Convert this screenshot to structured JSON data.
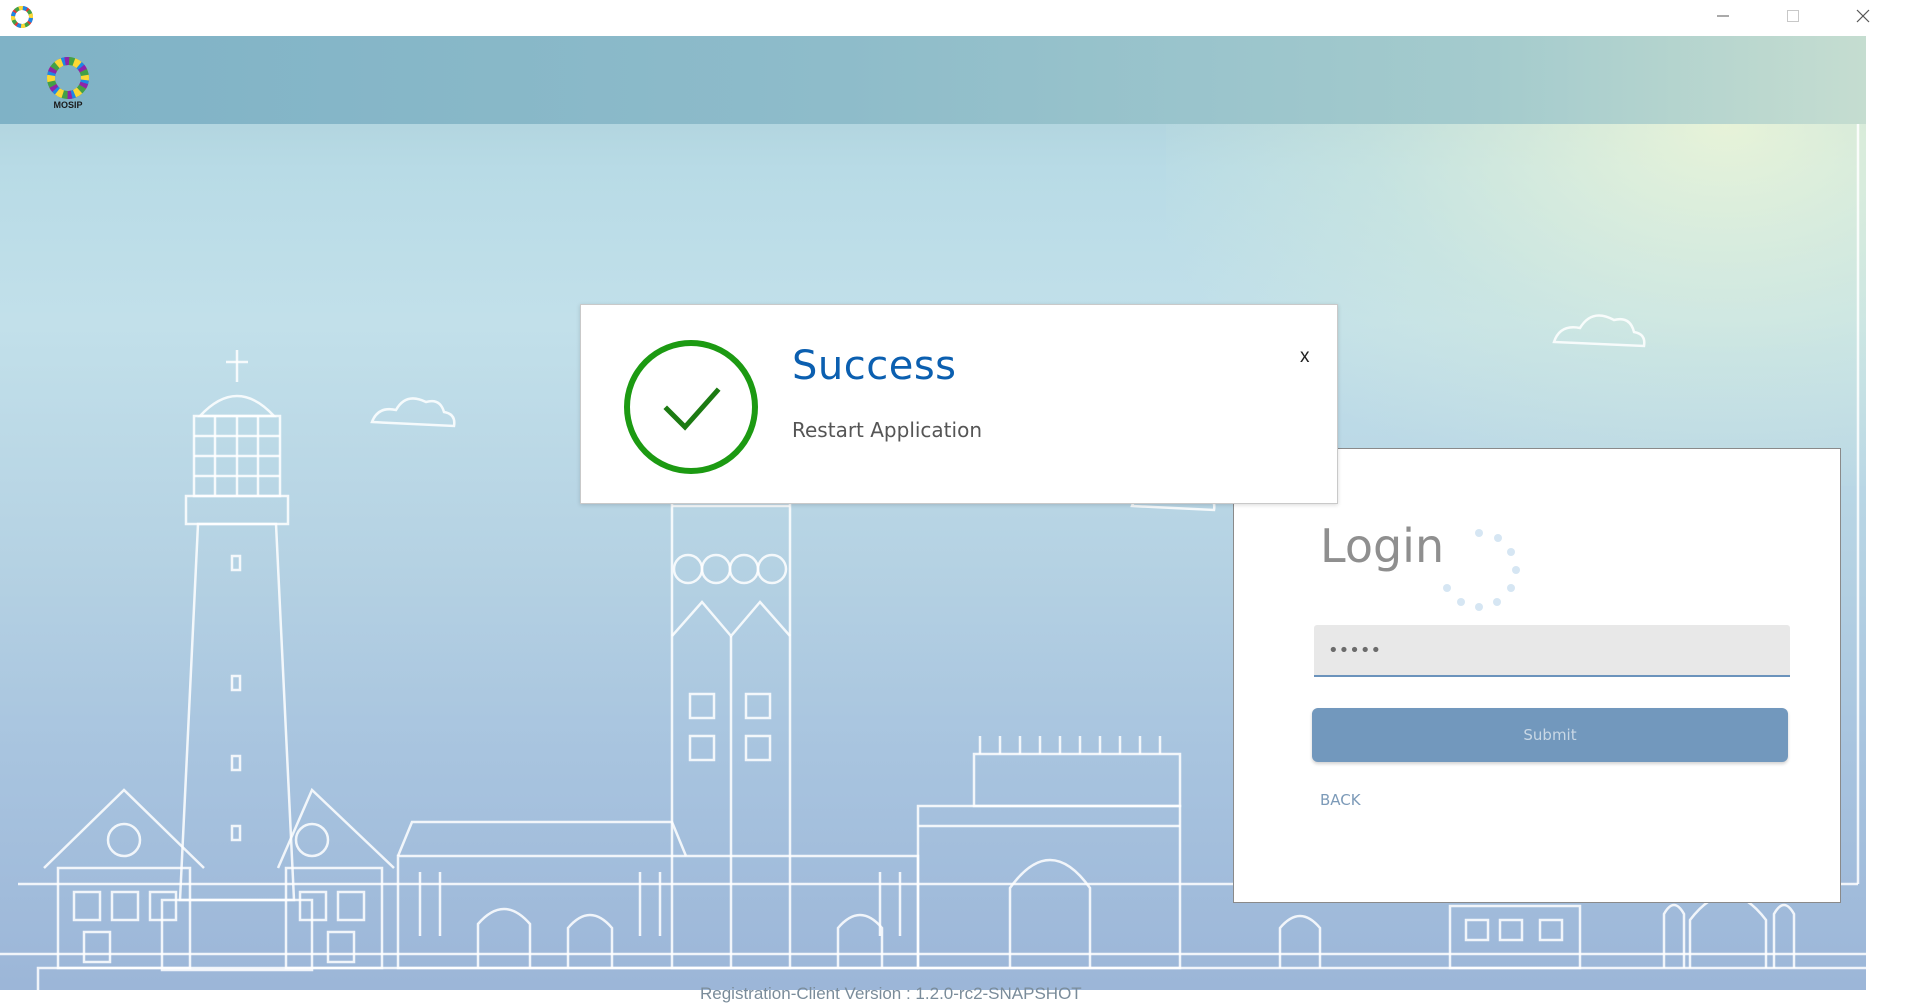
{
  "window": {
    "icon": "app-logo-icon",
    "controls": [
      "minimize-icon",
      "maximize-icon",
      "close-icon"
    ]
  },
  "header": {
    "logo_icon": "mosip-logo-icon",
    "logo_text": "MOSIP"
  },
  "success_dialog": {
    "title": "Success",
    "message": "Restart Application",
    "close_label": "x",
    "icon": "checkmark-circle-icon",
    "title_color": "#0b5fb0",
    "icon_color": "#1c9a12"
  },
  "login": {
    "title": "Login",
    "password_value": "•••••",
    "submit_label": "Submit",
    "back_label": "BACK",
    "spinner_icon": "loading-spinner-icon"
  },
  "footer": {
    "version_text": "Registration-Client Version : 1.2.0-rc2-SNAPSHOT"
  },
  "colors": {
    "submit_bg": "#7298bd",
    "input_underline": "#6b93bc"
  }
}
